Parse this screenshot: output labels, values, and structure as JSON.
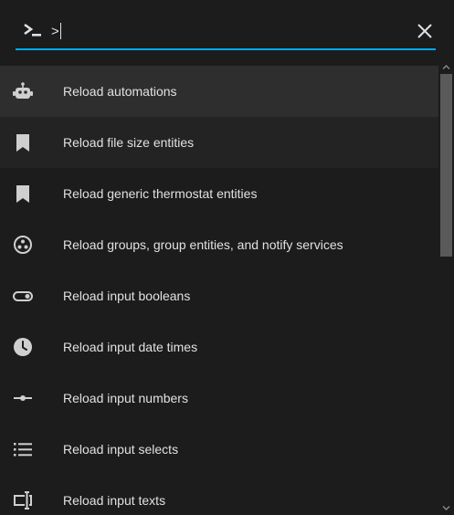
{
  "search": {
    "value": ">",
    "placeholder": ""
  },
  "icons": {
    "prompt": "console-icon",
    "close": "close-icon"
  },
  "colors": {
    "background": "#1c1c1c",
    "active_row": "#2e2e2e",
    "accent_underline": "#03a9f4",
    "text": "#e1e1e1",
    "icon": "#e1e1e1",
    "scroll_thumb": "#5a5a5a"
  },
  "commands": [
    {
      "label": "Reload automations",
      "icon": "robot-icon",
      "state": "active"
    },
    {
      "label": "Reload file size entities",
      "icon": "bookmark-icon",
      "state": "hover"
    },
    {
      "label": "Reload generic thermostat entities",
      "icon": "bookmark-icon",
      "state": ""
    },
    {
      "label": "Reload groups, group entities, and notify services",
      "icon": "group-circle-icon",
      "state": ""
    },
    {
      "label": "Reload input booleans",
      "icon": "toggle-switch-icon",
      "state": ""
    },
    {
      "label": "Reload input date times",
      "icon": "clock-icon",
      "state": ""
    },
    {
      "label": "Reload input numbers",
      "icon": "slider-icon",
      "state": ""
    },
    {
      "label": "Reload input selects",
      "icon": "format-list-icon",
      "state": ""
    },
    {
      "label": "Reload input texts",
      "icon": "form-textbox-icon",
      "state": ""
    }
  ]
}
